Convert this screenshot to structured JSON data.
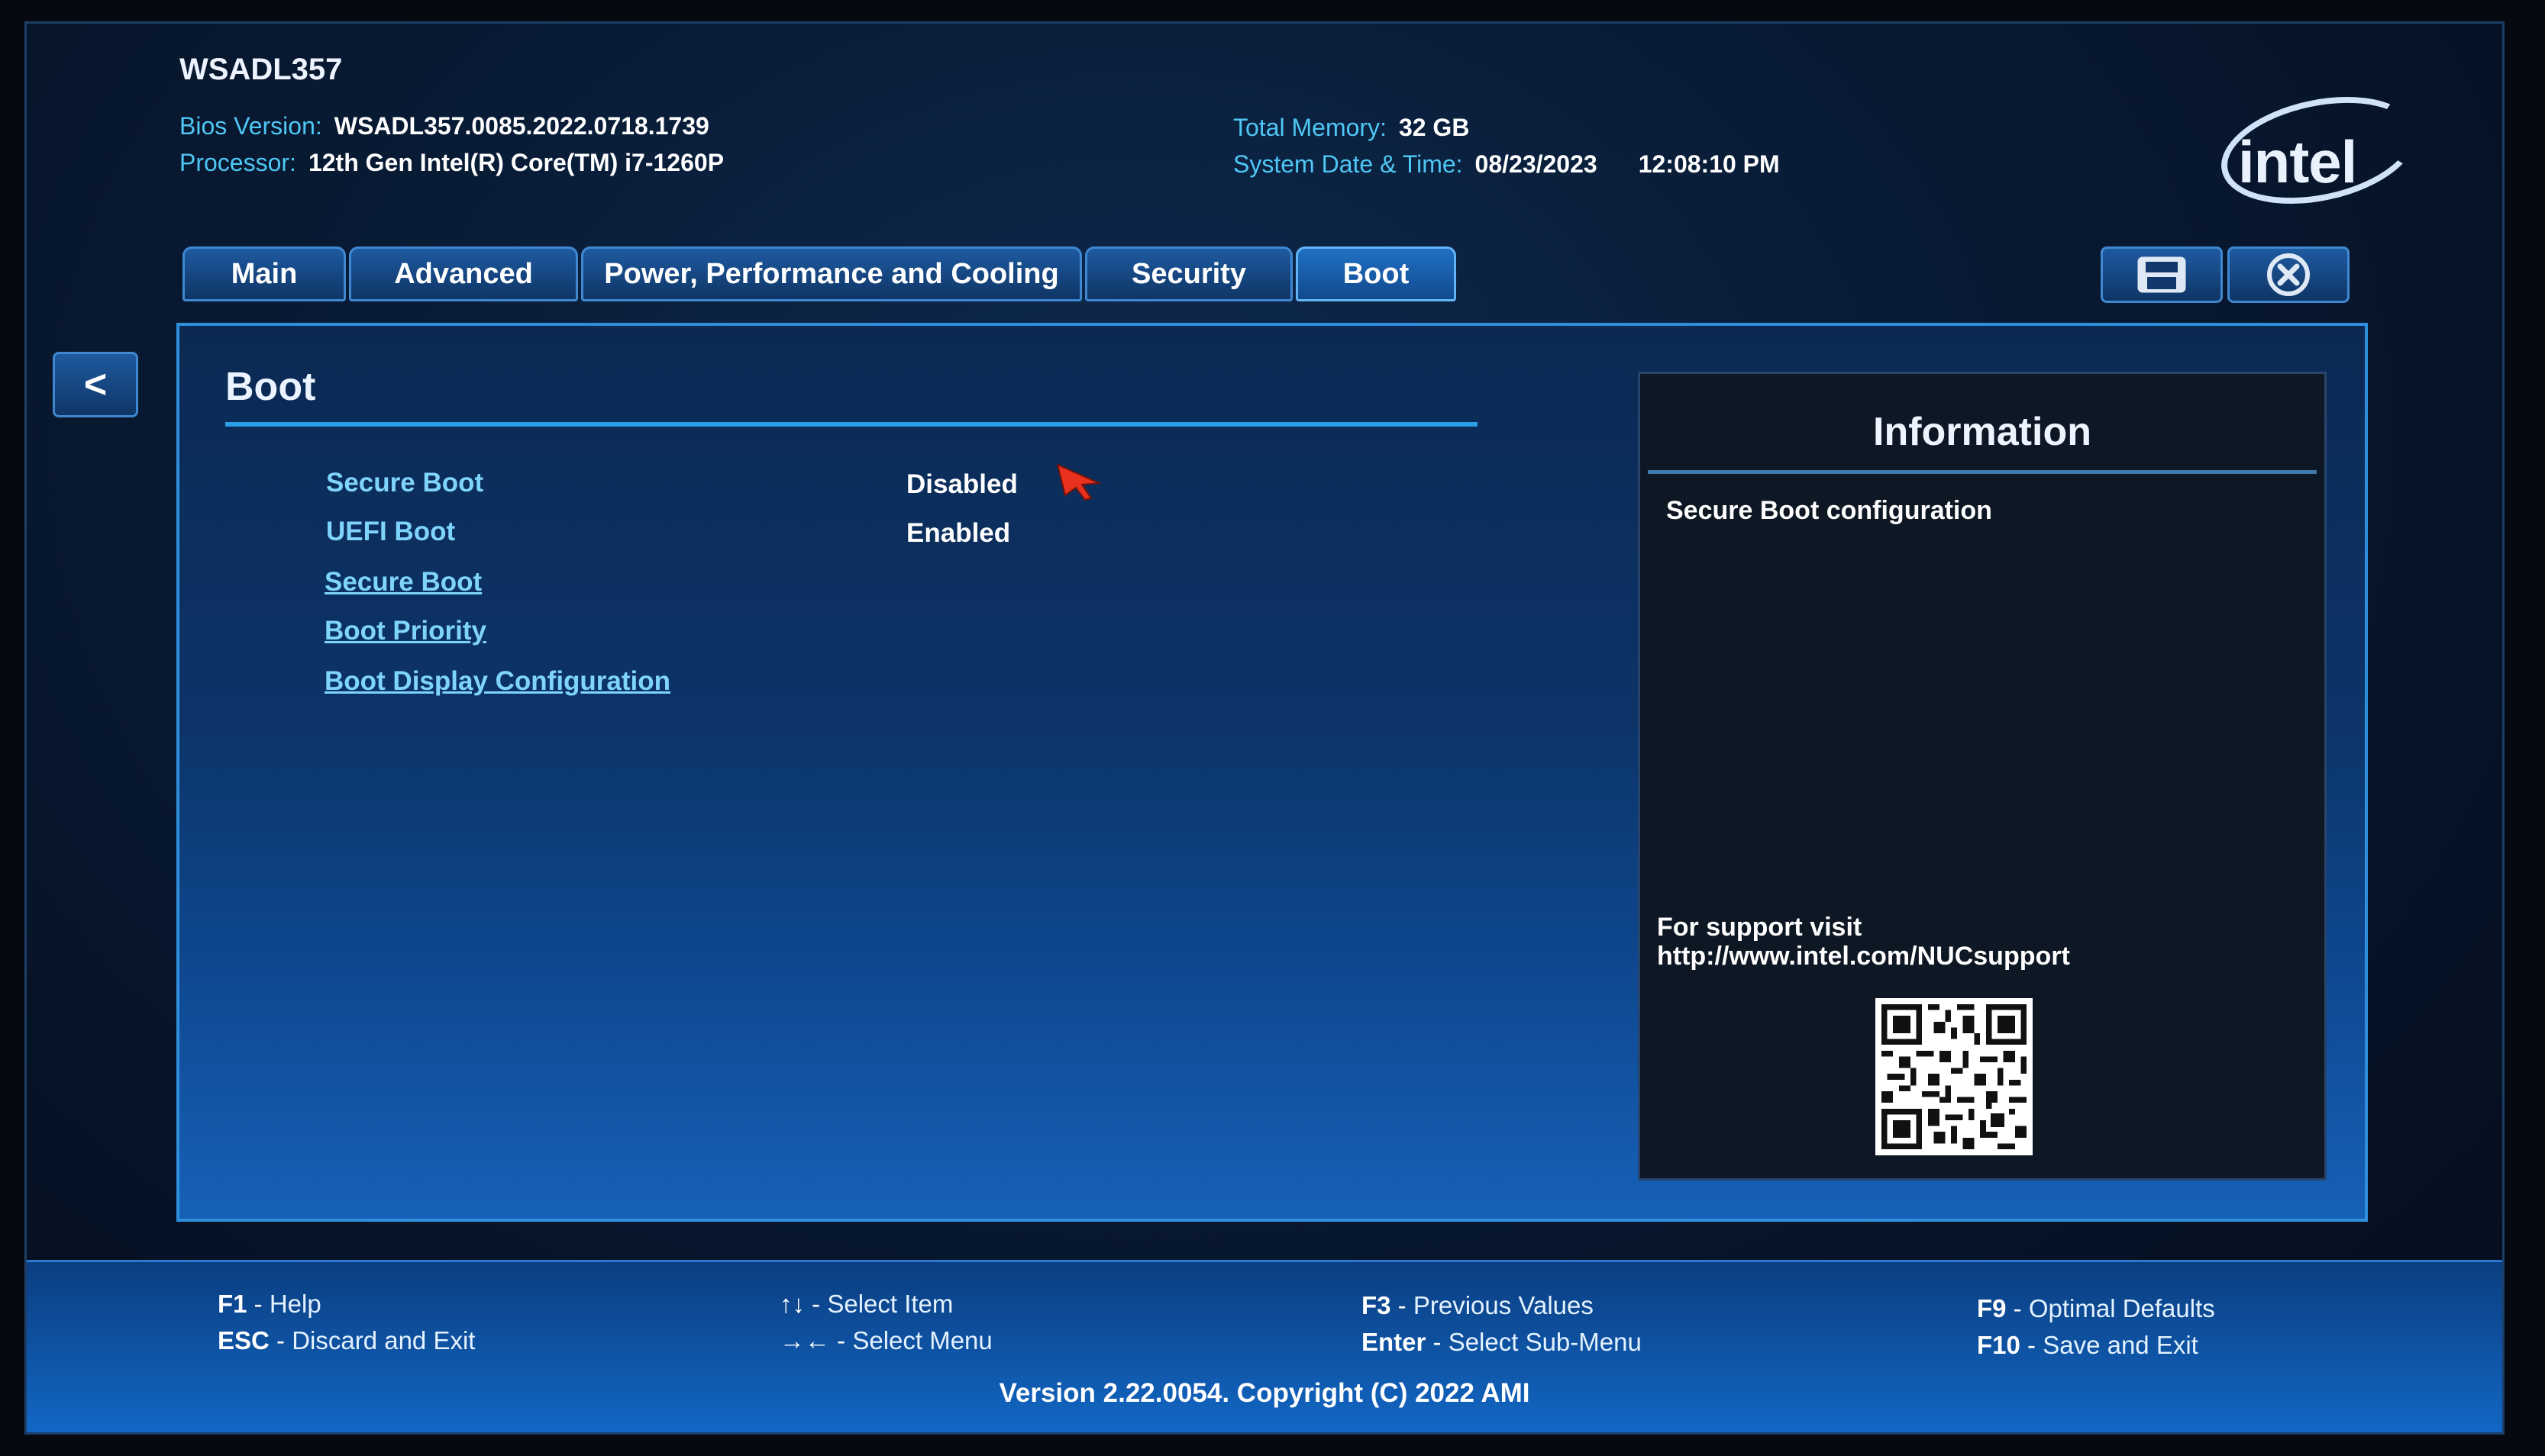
{
  "header": {
    "system_name": "WSADL357",
    "bios_version_label": "Bios Version:",
    "bios_version_value": "WSADL357.0085.2022.0718.1739",
    "processor_label": "Processor:",
    "processor_value": "12th Gen Intel(R) Core(TM) i7-1260P",
    "memory_label": "Total Memory:",
    "memory_value": "32 GB",
    "datetime_label": "System Date & Time:",
    "date_value": "08/23/2023",
    "time_value": "12:08:10 PM",
    "logo_text": "intel"
  },
  "tabs": [
    {
      "label": "Main",
      "active": false
    },
    {
      "label": "Advanced",
      "active": false
    },
    {
      "label": "Power, Performance and Cooling",
      "active": false
    },
    {
      "label": "Security",
      "active": false
    },
    {
      "label": "Boot",
      "active": true
    }
  ],
  "toolbar": {
    "save_icon": "save-icon",
    "exit_icon": "close-circle-icon",
    "back_label": "<"
  },
  "section": {
    "title": "Boot",
    "settings": [
      {
        "label": "Secure Boot",
        "value": "Disabled"
      },
      {
        "label": "UEFI Boot",
        "value": "Enabled"
      }
    ],
    "submenus": [
      {
        "label": "Secure Boot"
      },
      {
        "label": "Boot Priority"
      },
      {
        "label": "Boot Display Configuration"
      }
    ]
  },
  "info": {
    "title": "Information",
    "description": "Secure Boot configuration",
    "support_line1": "For support visit",
    "support_line2": "http://www.intel.com/NUCsupport"
  },
  "footer": {
    "keys": [
      {
        "key": "F1",
        "desc": "Help"
      },
      {
        "key": "ESC",
        "desc": "Discard and Exit"
      },
      {
        "key": "↑↓",
        "desc": "Select Item"
      },
      {
        "key": "→←",
        "desc": "Select Menu"
      },
      {
        "key": "F3",
        "desc": "Previous Values"
      },
      {
        "key": "Enter",
        "desc": "Select Sub-Menu"
      },
      {
        "key": "F9",
        "desc": "Optimal Defaults"
      },
      {
        "key": "F10",
        "desc": "Save and Exit"
      }
    ],
    "separator": " - ",
    "version": "Version 2.22.0054. Copyright (C) 2022 AMI"
  },
  "colors": {
    "accent_cyan": "#4fc7f5",
    "link_blue": "#7fd4fb",
    "cursor_red": "#e8321f"
  }
}
